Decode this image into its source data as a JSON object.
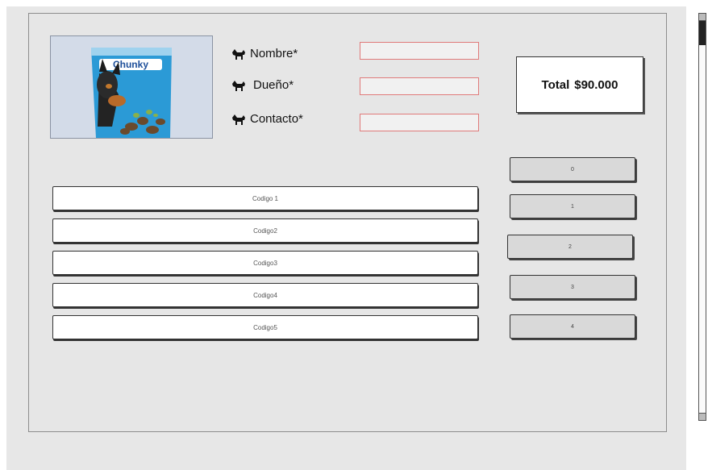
{
  "form": {
    "fields": [
      {
        "label": "Nombre*",
        "value": ""
      },
      {
        "label": "Dueño*",
        "value": ""
      },
      {
        "label": "Contacto*",
        "value": ""
      }
    ]
  },
  "product": {
    "brand": "Chunky",
    "icon": "dog-food-bag-image"
  },
  "total": {
    "label": "Total",
    "amount": "$90.000"
  },
  "codes": [
    "Codigo 1",
    "Codigo2",
    "Codigo3",
    "Codigo4",
    "Codigo5"
  ],
  "number_buttons": [
    "0",
    "1",
    "2",
    "3",
    "4"
  ],
  "colors": {
    "field_border": "#e07a7a",
    "panel_bg": "#e6e6e6",
    "product_bg": "#cfd8e6",
    "brand_blue": "#2a9fd8"
  }
}
